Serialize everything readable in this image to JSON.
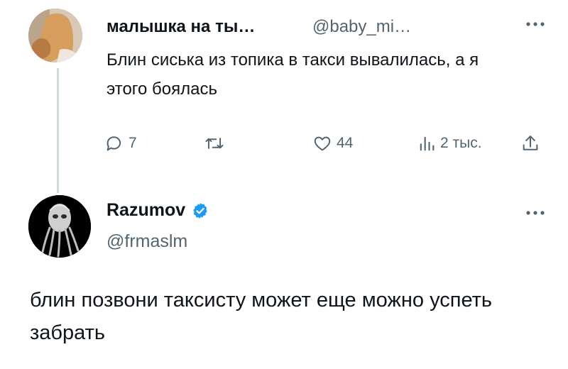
{
  "parent_tweet": {
    "display_name": "малышка на ты…",
    "handle": "@baby_mi…",
    "text": "Блин сиська из топика в такси вывалилась, а я этого боялась",
    "replies": "7",
    "likes": "44",
    "views": "2 тыс."
  },
  "reply_tweet": {
    "display_name": "Razumov",
    "handle": "@frmaslm",
    "text": "блин позвони таксисту может еще можно успеть забрать"
  },
  "colors": {
    "text_primary": "#0f1419",
    "text_secondary": "#536471",
    "verified_blue": "#1d9bf0",
    "thread_line": "#cfd9de"
  },
  "icons": [
    "more-icon",
    "reply-icon",
    "retweet-icon",
    "like-icon",
    "views-icon",
    "share-icon",
    "verified-icon"
  ]
}
